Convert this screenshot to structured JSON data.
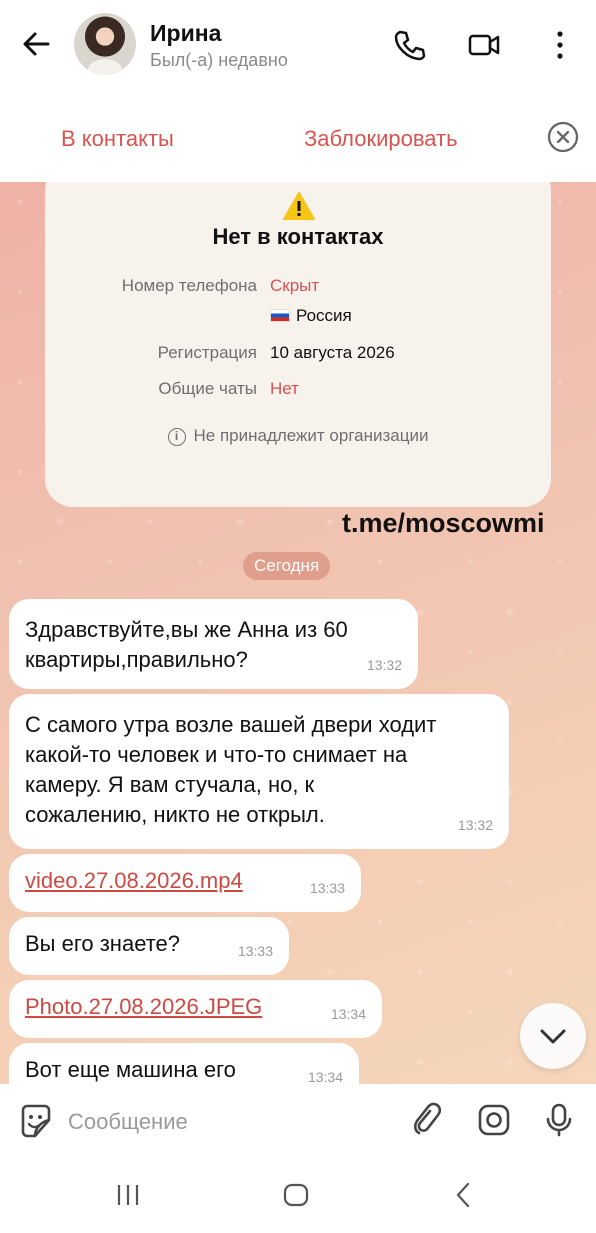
{
  "header": {
    "name": "Ирина",
    "status": "Был(-а) недавно"
  },
  "actions": {
    "add_contact": "В контакты",
    "block": "Заблокировать"
  },
  "info_card": {
    "title": "Нет в контактах",
    "phone_label": "Номер телефона",
    "phone_value": "Скрыт",
    "country": "Россия",
    "reg_label": "Регистрация",
    "reg_value": "10 августа 2026",
    "chats_label": "Общие чаты",
    "chats_value": "Нет",
    "org_note": "Не принадлежит организации"
  },
  "watermark": "t.me/moscowmi",
  "date_separator": "Сегодня",
  "messages": [
    {
      "text": "Здравствуйте,вы же Анна из 60 квартиры,правильно?",
      "time": "13:32"
    },
    {
      "text": "С самого утра возле вашей двери ходит какой-то человек и что-то снимает на камеру. Я вам стучала, но, к сожалению, никто не открыл.",
      "time": "13:32"
    },
    {
      "text": "video.27.08.2026.mp4",
      "time": "13:33"
    },
    {
      "text": "Вы его знаете?",
      "time": "13:33"
    },
    {
      "text": "Photo.27.08.2026.JPEG",
      "time": "13:34"
    },
    {
      "text": "Вот еще машина его",
      "time": "13:34"
    }
  ],
  "input": {
    "placeholder": "Сообщение"
  },
  "colors": {
    "accent_red": "#d9534f",
    "chat_bg_start": "#efb2a6",
    "chat_bg_end": "#f5d7bb"
  }
}
